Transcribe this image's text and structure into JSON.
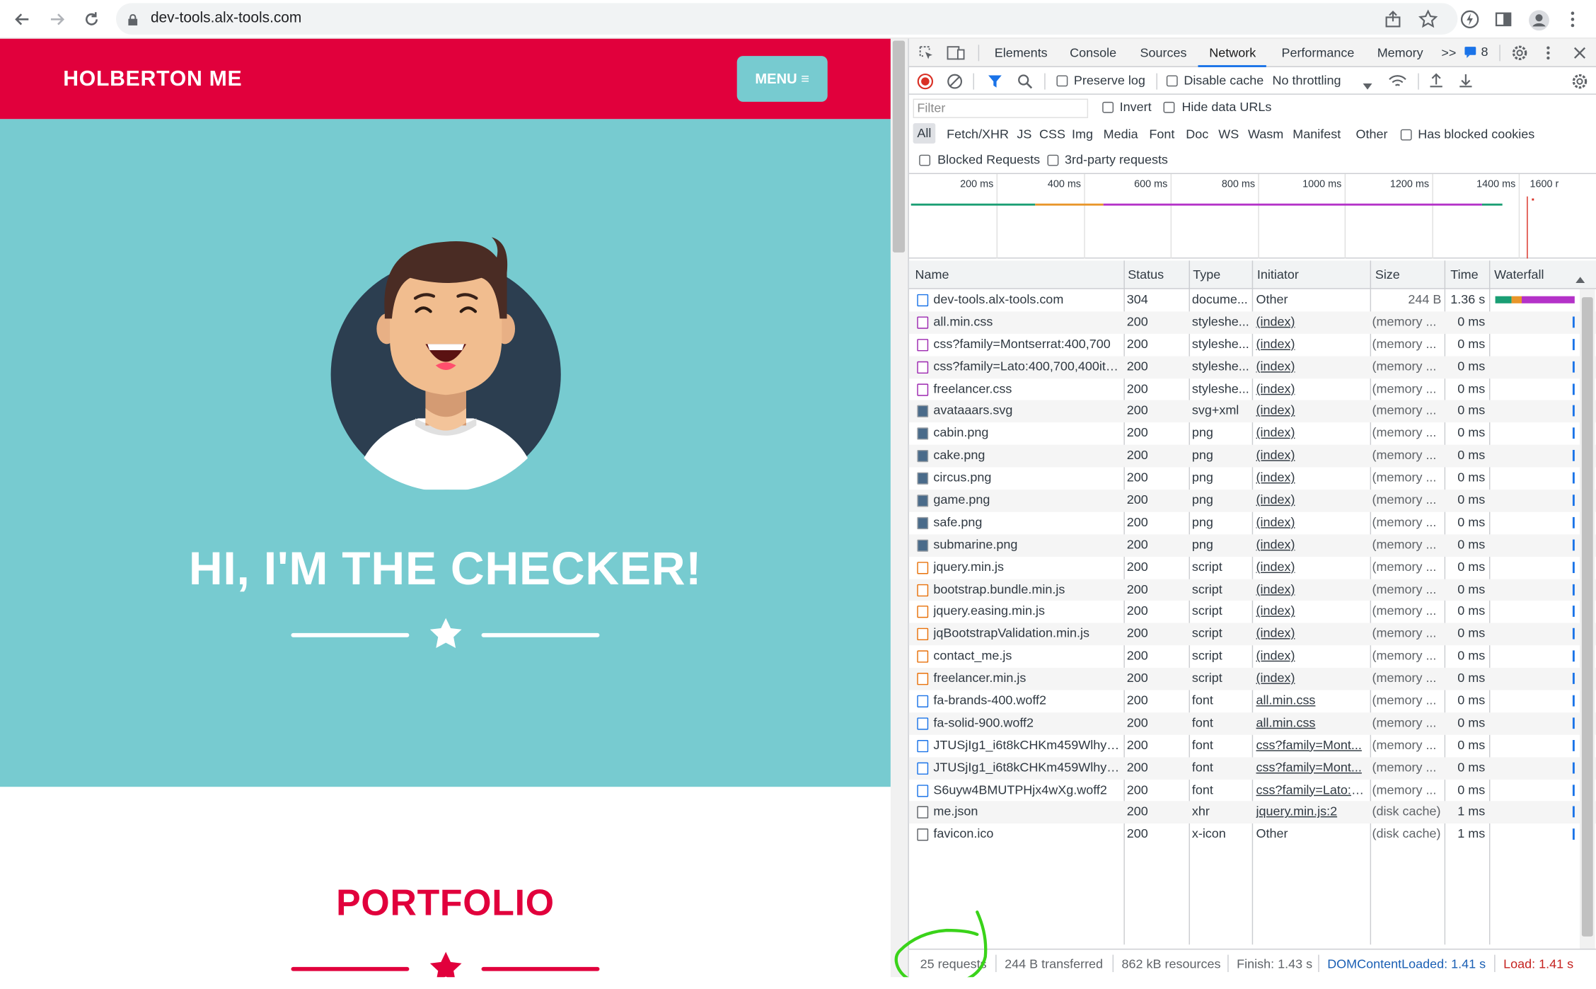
{
  "browser": {
    "url": "dev-tools.alx-tools.com",
    "nav_icons": [
      "back-arrow-icon",
      "forward-arrow-icon",
      "reload-icon"
    ],
    "toolbar_icons": [
      "share-icon",
      "star-icon",
      "lightning-icon",
      "sidebar-icon",
      "profile-icon",
      "kebab-icon"
    ]
  },
  "site": {
    "brand": "HOLBERTON ME",
    "menu_label": "MENU ≡",
    "hero_title": "HI, I'M THE CHECKER!",
    "portfolio_title": "PORTFOLIO",
    "colors": {
      "primary": "#e1003c",
      "hero": "#77cbd0",
      "avatar_bg": "#2c3e50"
    }
  },
  "devtools": {
    "tabs": [
      "Elements",
      "Console",
      "Sources",
      "Network",
      "Performance",
      "Memory"
    ],
    "active_tab": "Network",
    "more_tabs": ">>",
    "issues_count": "8",
    "toolbar": {
      "preserve_log": "Preserve log",
      "disable_cache": "Disable cache",
      "throttling": "No throttling"
    },
    "filter_placeholder": "Filter",
    "invert": "Invert",
    "hide_data_urls": "Hide data URLs",
    "types": [
      "All",
      "Fetch/XHR",
      "JS",
      "CSS",
      "Img",
      "Media",
      "Font",
      "Doc",
      "WS",
      "Wasm",
      "Manifest",
      "Other"
    ],
    "has_blocked_cookies": "Has blocked cookies",
    "blocked_requests": "Blocked Requests",
    "third_party": "3rd-party requests",
    "overview_ticks": [
      "200 ms",
      "400 ms",
      "600 ms",
      "800 ms",
      "1000 ms",
      "1200 ms",
      "1400 ms",
      "1600 r"
    ],
    "columns": [
      "Name",
      "Status",
      "Type",
      "Initiator",
      "Size",
      "Time",
      "Waterfall"
    ],
    "requests": [
      {
        "name": "dev-tools.alx-tools.com",
        "status": "304",
        "type": "docume...",
        "initiator": "Other",
        "size": "244 B",
        "time": "1.36 s",
        "icon": "doc"
      },
      {
        "name": "all.min.css",
        "status": "200",
        "type": "styleshe...",
        "initiator": "(index)",
        "size": "(memory ...",
        "time": "0 ms",
        "icon": "css"
      },
      {
        "name": "css?family=Montserrat:400,700",
        "status": "200",
        "type": "styleshe...",
        "initiator": "(index)",
        "size": "(memory ...",
        "time": "0 ms",
        "icon": "css"
      },
      {
        "name": "css?family=Lato:400,700,400ita...",
        "status": "200",
        "type": "styleshe...",
        "initiator": "(index)",
        "size": "(memory ...",
        "time": "0 ms",
        "icon": "css"
      },
      {
        "name": "freelancer.css",
        "status": "200",
        "type": "styleshe...",
        "initiator": "(index)",
        "size": "(memory ...",
        "time": "0 ms",
        "icon": "css"
      },
      {
        "name": "avataaars.svg",
        "status": "200",
        "type": "svg+xml",
        "initiator": "(index)",
        "size": "(memory ...",
        "time": "0 ms",
        "icon": "img"
      },
      {
        "name": "cabin.png",
        "status": "200",
        "type": "png",
        "initiator": "(index)",
        "size": "(memory ...",
        "time": "0 ms",
        "icon": "img"
      },
      {
        "name": "cake.png",
        "status": "200",
        "type": "png",
        "initiator": "(index)",
        "size": "(memory ...",
        "time": "0 ms",
        "icon": "img"
      },
      {
        "name": "circus.png",
        "status": "200",
        "type": "png",
        "initiator": "(index)",
        "size": "(memory ...",
        "time": "0 ms",
        "icon": "img"
      },
      {
        "name": "game.png",
        "status": "200",
        "type": "png",
        "initiator": "(index)",
        "size": "(memory ...",
        "time": "0 ms",
        "icon": "img"
      },
      {
        "name": "safe.png",
        "status": "200",
        "type": "png",
        "initiator": "(index)",
        "size": "(memory ...",
        "time": "0 ms",
        "icon": "img"
      },
      {
        "name": "submarine.png",
        "status": "200",
        "type": "png",
        "initiator": "(index)",
        "size": "(memory ...",
        "time": "0 ms",
        "icon": "img"
      },
      {
        "name": "jquery.min.js",
        "status": "200",
        "type": "script",
        "initiator": "(index)",
        "size": "(memory ...",
        "time": "0 ms",
        "icon": "js"
      },
      {
        "name": "bootstrap.bundle.min.js",
        "status": "200",
        "type": "script",
        "initiator": "(index)",
        "size": "(memory ...",
        "time": "0 ms",
        "icon": "js"
      },
      {
        "name": "jquery.easing.min.js",
        "status": "200",
        "type": "script",
        "initiator": "(index)",
        "size": "(memory ...",
        "time": "0 ms",
        "icon": "js"
      },
      {
        "name": "jqBootstrapValidation.min.js",
        "status": "200",
        "type": "script",
        "initiator": "(index)",
        "size": "(memory ...",
        "time": "0 ms",
        "icon": "js"
      },
      {
        "name": "contact_me.js",
        "status": "200",
        "type": "script",
        "initiator": "(index)",
        "size": "(memory ...",
        "time": "0 ms",
        "icon": "js"
      },
      {
        "name": "freelancer.min.js",
        "status": "200",
        "type": "script",
        "initiator": "(index)",
        "size": "(memory ...",
        "time": "0 ms",
        "icon": "js"
      },
      {
        "name": "fa-brands-400.woff2",
        "status": "200",
        "type": "font",
        "initiator": "all.min.css",
        "size": "(memory ...",
        "time": "0 ms",
        "icon": "font"
      },
      {
        "name": "fa-solid-900.woff2",
        "status": "200",
        "type": "font",
        "initiator": "all.min.css",
        "size": "(memory ...",
        "time": "0 ms",
        "icon": "font"
      },
      {
        "name": "JTUSjIg1_i6t8kCHKm459Wlhyw...",
        "status": "200",
        "type": "font",
        "initiator": "css?family=Mont...",
        "size": "(memory ...",
        "time": "0 ms",
        "icon": "font"
      },
      {
        "name": "JTUSjIg1_i6t8kCHKm459Wlhyw...",
        "status": "200",
        "type": "font",
        "initiator": "css?family=Mont...",
        "size": "(memory ...",
        "time": "0 ms",
        "icon": "font"
      },
      {
        "name": "S6uyw4BMUTPHjx4wXg.woff2",
        "status": "200",
        "type": "font",
        "initiator": "css?family=Lato:4...",
        "size": "(memory ...",
        "time": "0 ms",
        "icon": "font"
      },
      {
        "name": "me.json",
        "status": "200",
        "type": "xhr",
        "initiator": "jquery.min.js:2",
        "size": "(disk cache)",
        "time": "1 ms",
        "icon": "other"
      },
      {
        "name": "favicon.ico",
        "status": "200",
        "type": "x-icon",
        "initiator": "Other",
        "size": "(disk cache)",
        "time": "1 ms",
        "icon": "other"
      }
    ],
    "status_bar": {
      "requests": "25 requests",
      "transferred": "244 B transferred",
      "resources": "862 kB resources",
      "finish": "Finish: 1.43 s",
      "dom_content_loaded": "DOMContentLoaded: 1.41 s",
      "load": "Load: 1.41 s"
    }
  }
}
